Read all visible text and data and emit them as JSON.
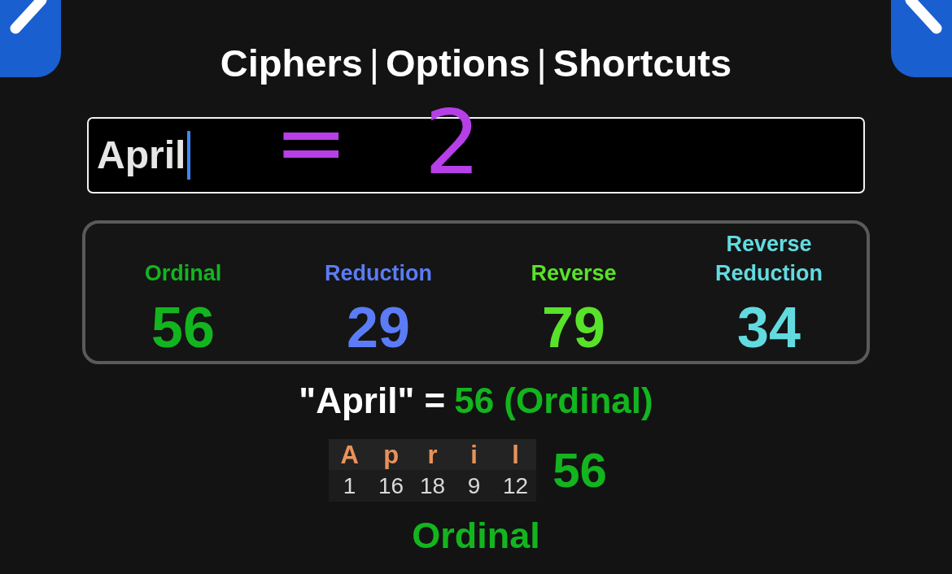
{
  "nav": {
    "links": [
      {
        "label": "Ciphers"
      },
      {
        "label": "Options"
      },
      {
        "label": "Shortcuts"
      }
    ],
    "separators": [
      "|",
      "|"
    ]
  },
  "input": {
    "value": "April",
    "focused": true
  },
  "annotation": "= 2",
  "ciphers": [
    {
      "name": "Ordinal",
      "value": "56",
      "color": "#13b51f"
    },
    {
      "name": "Reduction",
      "value": "29",
      "color": "#5b7cf6"
    },
    {
      "name": "Reverse",
      "value": "79",
      "color": "#58e22a"
    },
    {
      "name": "Reverse Reduction",
      "value": "34",
      "color": "#62dbe0"
    }
  ],
  "summary": {
    "phrase": "\"April\" =",
    "result": "56 (Ordinal)"
  },
  "breakdown": {
    "letters": [
      {
        "char": "A",
        "value": "1"
      },
      {
        "char": "p",
        "value": "16"
      },
      {
        "char": "r",
        "value": "18"
      },
      {
        "char": "i",
        "value": "9"
      },
      {
        "char": "l",
        "value": "12"
      }
    ],
    "total": "56",
    "cipher": "Ordinal"
  }
}
